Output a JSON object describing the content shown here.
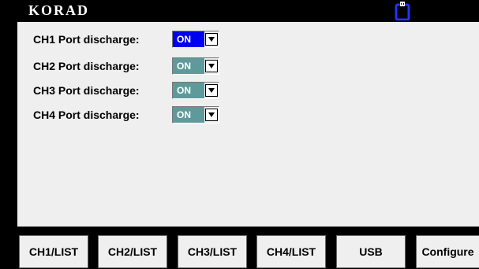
{
  "header": {
    "brand": "KORAD",
    "usb_icon": "usb-drive-icon",
    "usb_color": "#0000ff"
  },
  "settings": [
    {
      "label": "CH1 Port discharge:",
      "value": "ON",
      "focused": true
    },
    {
      "label": "CH2 Port discharge:",
      "value": "ON",
      "focused": false
    },
    {
      "label": "CH3 Port discharge:",
      "value": "ON",
      "focused": false
    },
    {
      "label": "CH4 Port discharge:",
      "value": "ON",
      "focused": false
    }
  ],
  "softkeys": [
    {
      "label": "CH1/LIST"
    },
    {
      "label": "CH2/LIST"
    },
    {
      "label": "CH3/LIST"
    },
    {
      "label": "CH4/LIST"
    },
    {
      "label": "USB"
    },
    {
      "label": "Configure"
    }
  ],
  "colors": {
    "focused_value_bg": "#0000ee",
    "value_bg": "#5e9a9a",
    "panel_bg": "#efefef",
    "screen_bg": "#000000"
  }
}
